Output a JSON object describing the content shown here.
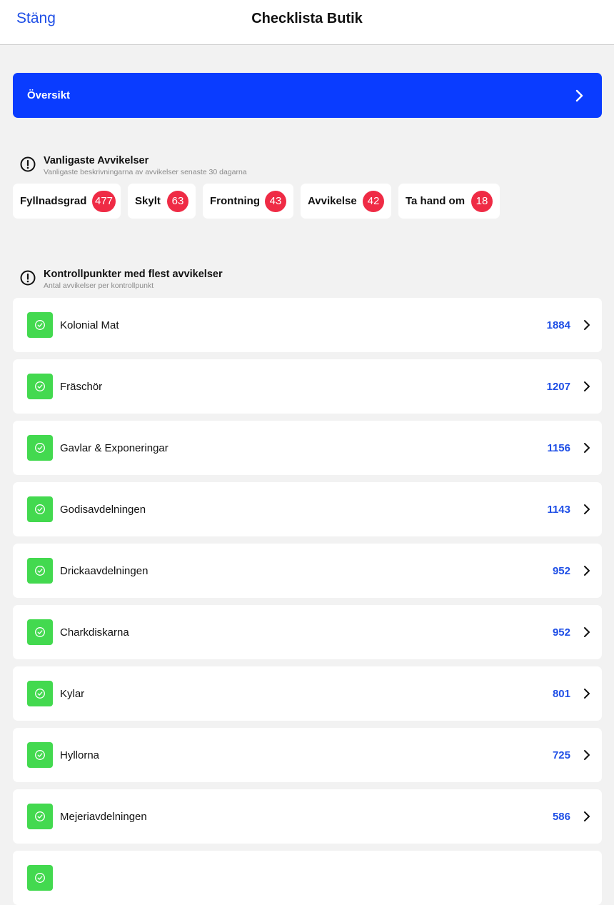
{
  "nav": {
    "close_label": "Stäng",
    "title": "Checklista Butik"
  },
  "overview": {
    "label": "Översikt"
  },
  "common_deviations": {
    "title": "Vanligaste Avvikelser",
    "subtitle": "Vanligaste beskrivningarna av avvikelser senaste 30 dagarna",
    "chips": [
      {
        "label": "Fyllnadsgrad",
        "count": "477"
      },
      {
        "label": "Skylt",
        "count": "63"
      },
      {
        "label": "Frontning",
        "count": "43"
      },
      {
        "label": "Avvikelse",
        "count": "42"
      },
      {
        "label": "Ta hand om",
        "count": "18"
      }
    ]
  },
  "checkpoints": {
    "title": "Kontrollpunkter med flest avvikelser",
    "subtitle": "Antal avvikelser per kontrollpunkt",
    "items": [
      {
        "label": "Kolonial Mat",
        "count": "1884"
      },
      {
        "label": "Fräschör",
        "count": "1207"
      },
      {
        "label": "Gavlar & Exponeringar",
        "count": "1156"
      },
      {
        "label": "Godisavdelningen",
        "count": "1143"
      },
      {
        "label": "Drickaavdelningen",
        "count": "952"
      },
      {
        "label": "Charkdiskarna",
        "count": "952"
      },
      {
        "label": "Kylar",
        "count": "801"
      },
      {
        "label": "Hyllorna",
        "count": "725"
      },
      {
        "label": "Mejeriavdelningen",
        "count": "586"
      },
      {
        "label": "",
        "count": ""
      }
    ]
  },
  "colors": {
    "accent": "#0a3cff",
    "link": "#1f4fe6",
    "badge": "#ef2b45",
    "status_ok": "#43d94f"
  },
  "icons": {
    "section": "exclamation-circle-icon",
    "row_status": "check-circle-icon",
    "disclosure": "chevron-right-icon"
  }
}
